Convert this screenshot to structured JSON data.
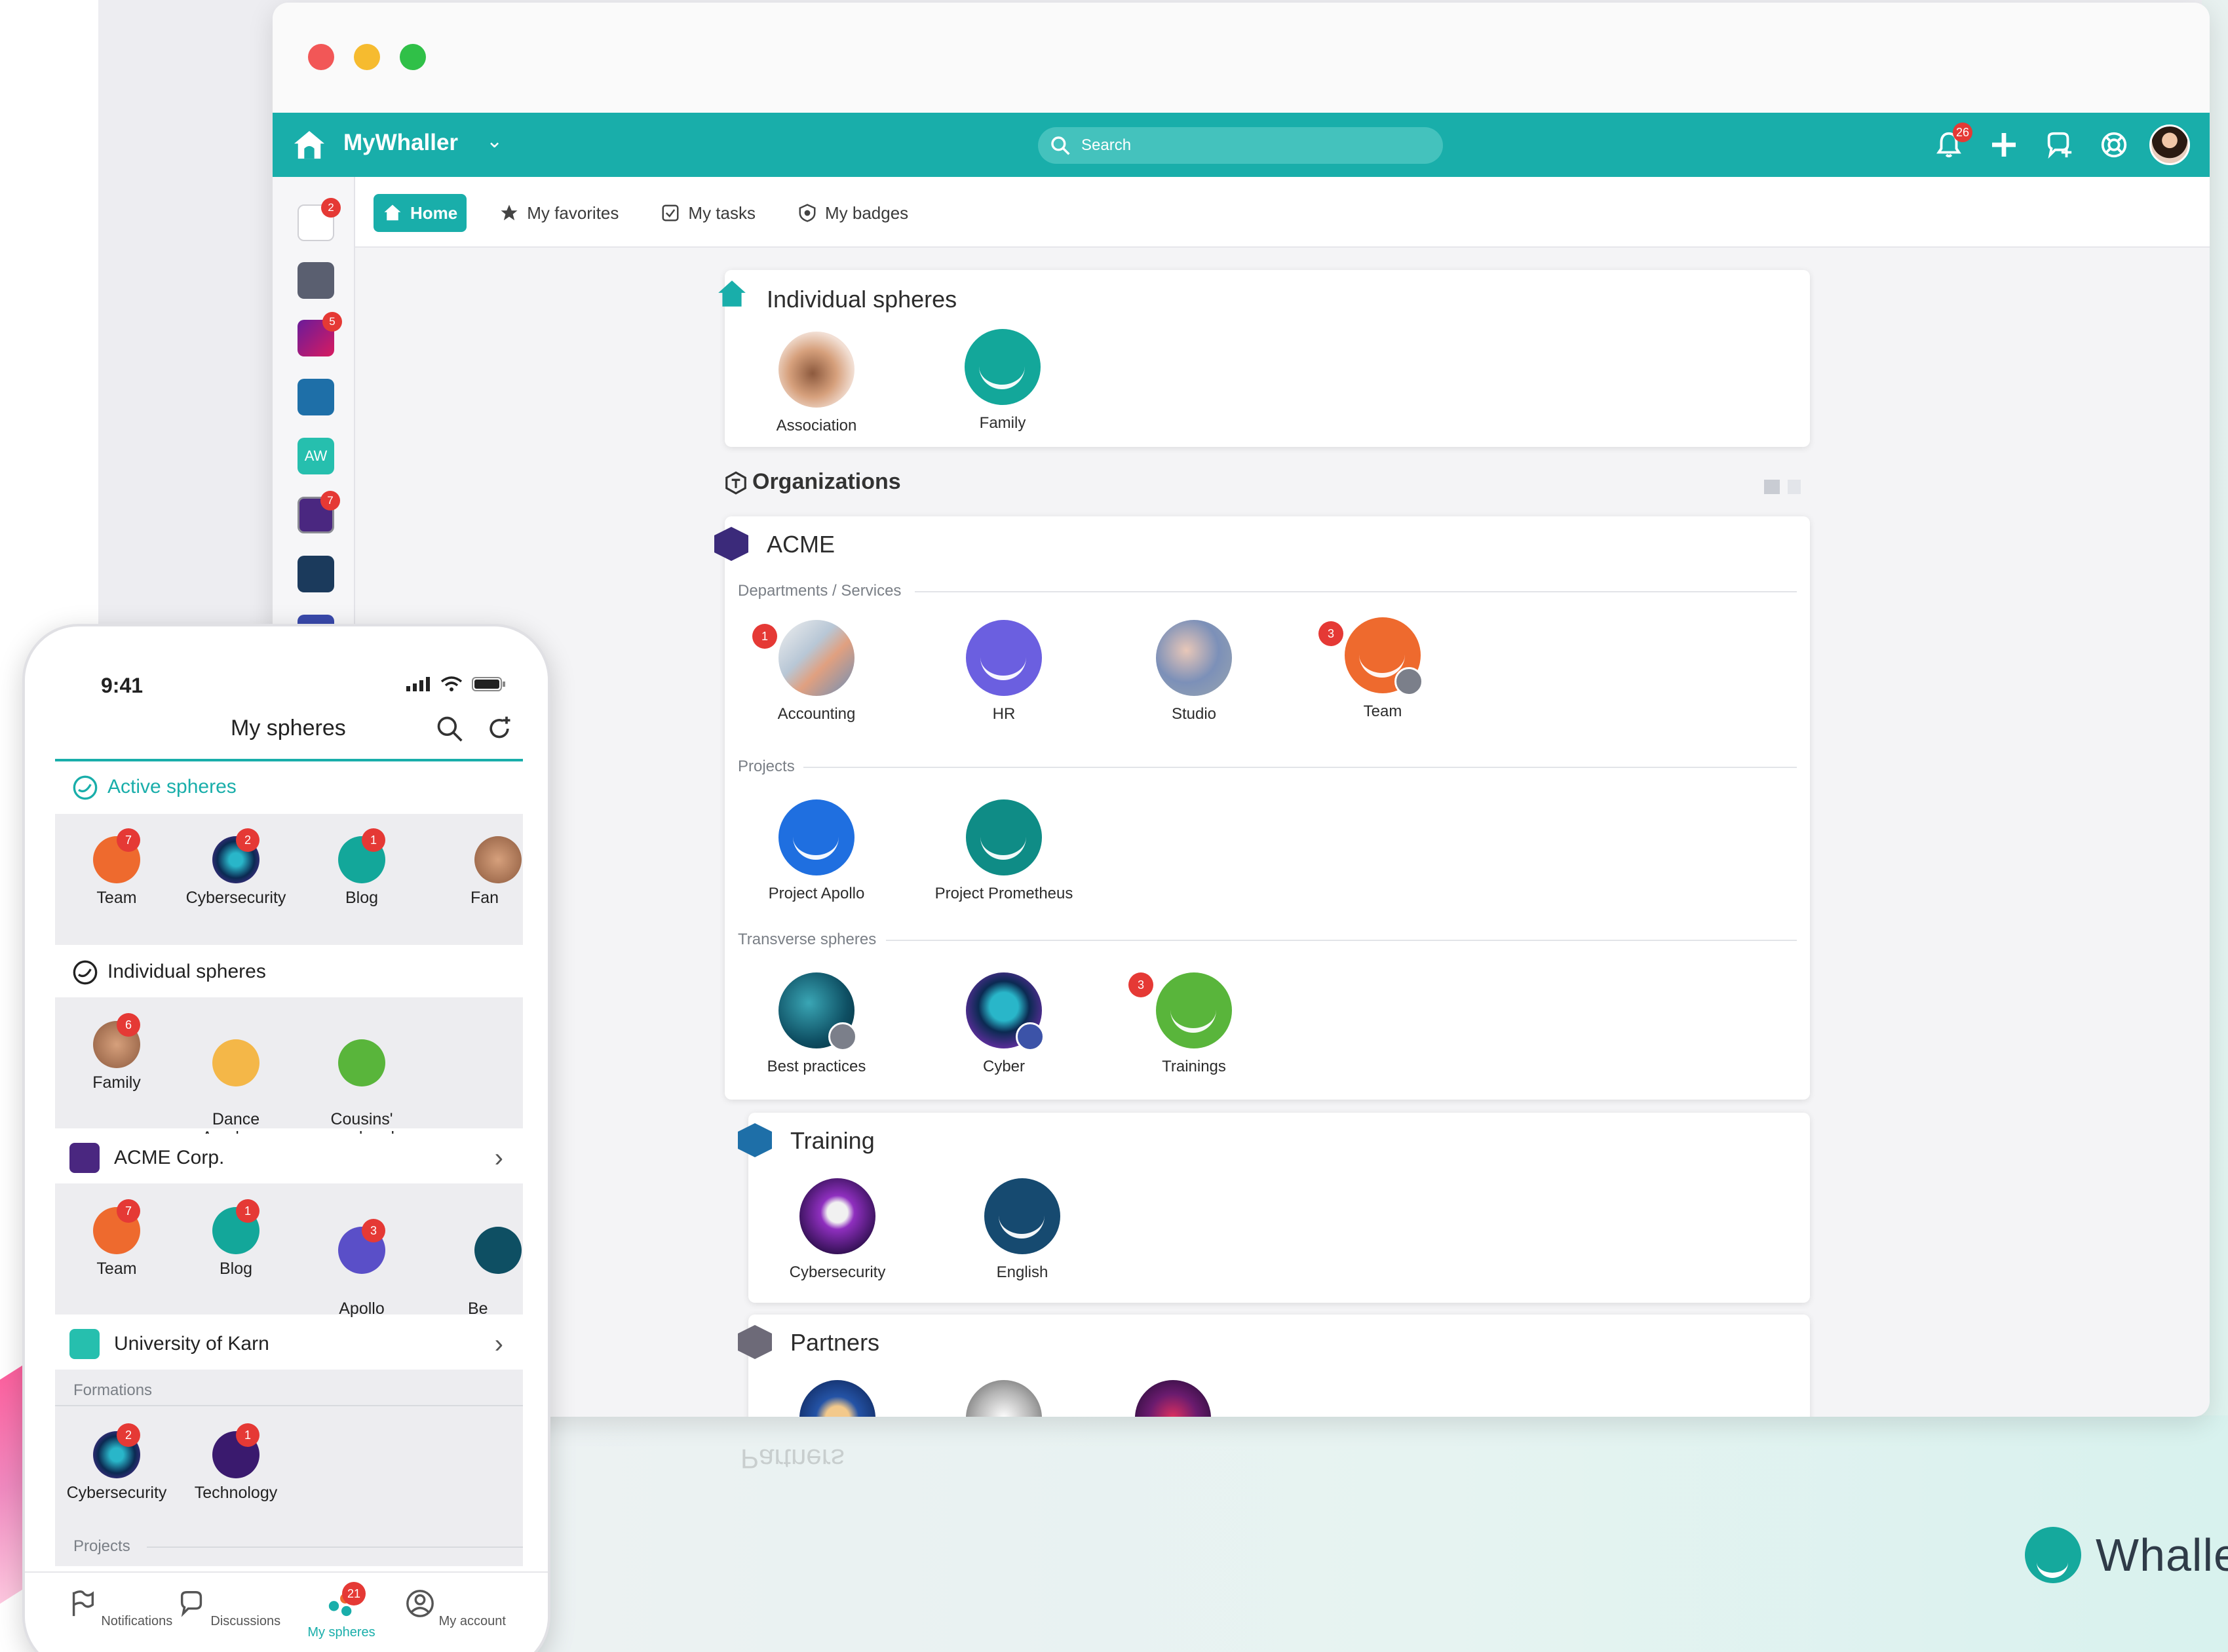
{
  "colors": {
    "teal": "#19aeaa",
    "badge_red": "#e53935"
  },
  "app": {
    "brand": "MyWhaller",
    "search_placeholder": "Search",
    "notifications_count": "26"
  },
  "rail": {
    "badges": [
      "2",
      "5",
      "7"
    ]
  },
  "tabs": [
    "Home",
    "My favorites",
    "My tasks",
    "My badges"
  ],
  "individual": {
    "title": "Individual spheres",
    "items": [
      {
        "label": "Association"
      },
      {
        "label": "Family"
      }
    ]
  },
  "organizations": {
    "title": "Organizations",
    "acme": {
      "name": "ACME",
      "sections": {
        "departments": "Departments / Services",
        "projects": "Projects",
        "transverse": "Transverse spheres"
      },
      "departments": [
        {
          "label": "Accounting",
          "badge": "1"
        },
        {
          "label": "HR",
          "badge": ""
        },
        {
          "label": "Studio",
          "badge": ""
        },
        {
          "label": "Team",
          "badge": "3"
        }
      ],
      "projects": [
        {
          "label": "Project Apollo"
        },
        {
          "label": "Project Prometheus"
        }
      ],
      "transverse": [
        {
          "label": "Best practices",
          "badge": ""
        },
        {
          "label": "Cyber",
          "badge": ""
        },
        {
          "label": "Trainings",
          "badge": "3"
        }
      ]
    },
    "training": {
      "name": "Training",
      "items": [
        {
          "label": "Cybersecurity"
        },
        {
          "label": "English"
        }
      ]
    },
    "partners": {
      "name": "Partners"
    }
  },
  "phone": {
    "time": "9:41",
    "title": "My spheres",
    "active_title": "Active spheres",
    "active": [
      {
        "label": "Team",
        "badge": "7"
      },
      {
        "label": "Cybersecurity",
        "badge": "2"
      },
      {
        "label": "Blog",
        "badge": "1"
      },
      {
        "label": "Fan",
        "badge": ""
      }
    ],
    "individual_title": "Individual spheres",
    "individual": [
      {
        "label": "Family",
        "badge": "6"
      },
      {
        "label": "Dance\nAcademy",
        "badge": ""
      },
      {
        "label": "Cousins'\nweekend",
        "badge": ""
      }
    ],
    "org1": "ACME Corp.",
    "org1_items": [
      {
        "label": "Team",
        "badge": "7"
      },
      {
        "label": "Blog",
        "badge": "1"
      },
      {
        "label": "Apollo\nproject",
        "badge": "3"
      },
      {
        "label": "Be\nPrac",
        "badge": ""
      }
    ],
    "org2": "University of Karn",
    "formations_label": "Formations",
    "formations": [
      {
        "label": "Cybersecurity",
        "badge": "2"
      },
      {
        "label": "Technology",
        "badge": "1"
      }
    ],
    "projects_label": "Projects",
    "nav": [
      {
        "label": "Notifications"
      },
      {
        "label": "Discussions"
      },
      {
        "label": "My spheres",
        "badge": "21"
      },
      {
        "label": "My account"
      }
    ]
  },
  "brand_word": "Whalle",
  "reflection_text": "Partners"
}
